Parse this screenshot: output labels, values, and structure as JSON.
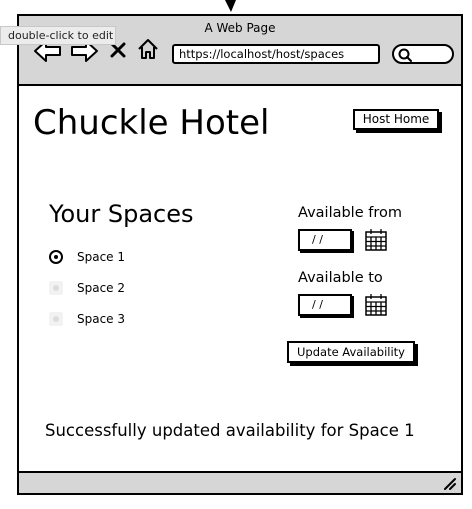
{
  "window": {
    "title": "A Web Page"
  },
  "tooltip": {
    "text": "double-click to edit"
  },
  "browser": {
    "url": "https://localhost/host/spaces"
  },
  "page": {
    "title": "Chuckle Hotel",
    "host_home_label": "Host Home",
    "spaces_heading": "Your Spaces",
    "spaces": [
      {
        "label": "Space 1",
        "selected": true
      },
      {
        "label": "Space 2",
        "selected": false
      },
      {
        "label": "Space 3",
        "selected": false
      }
    ],
    "available_from_label": "Available from",
    "available_from_value": "/ /",
    "available_to_label": "Available to",
    "available_to_value": "/ /",
    "update_label": "Update Availability",
    "success_message": "Successfully updated availability for Space 1"
  },
  "icons": [
    "back-arrow-icon",
    "forward-arrow-icon",
    "close-icon",
    "home-icon",
    "search-icon",
    "calendar-icon",
    "resize-grip-icon",
    "cursor-arrow-icon"
  ]
}
